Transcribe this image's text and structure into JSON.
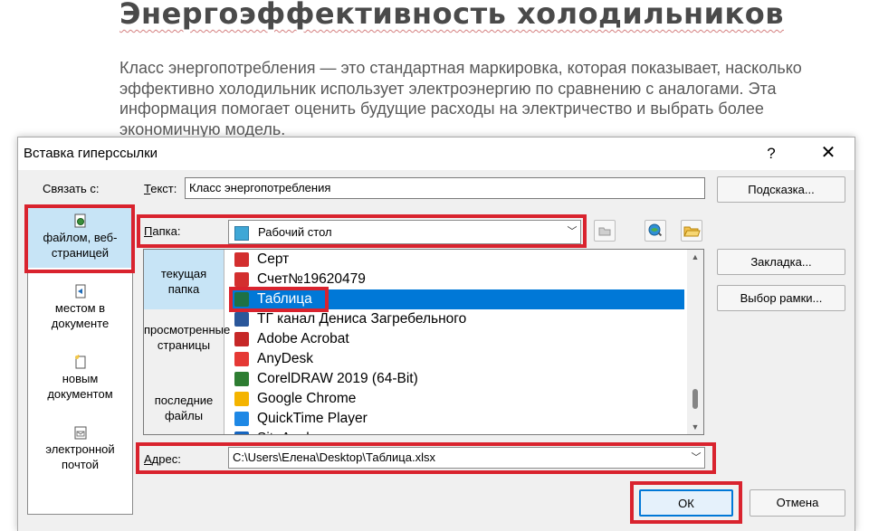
{
  "document": {
    "title": "Энергоэффективность холодильников",
    "paragraph": "Класс энергопотребления — это стандартная маркировка, которая показывает, насколько эффективно холодильник использует электроэнергию по сравнению с аналогами. Эта информация помогает оценить будущие расходы на электричество и выбрать более экономичную модель."
  },
  "dialog": {
    "title": "Вставка гиперссылки",
    "help": "?",
    "close": "✕",
    "link_to_label": "Связать с:",
    "text_label": "Текст:",
    "text_value": "Класс энергопотребления",
    "tooltip_button": "Подсказка...",
    "folder_label": "Папка:",
    "folder_value": "Рабочий стол",
    "bookmark_button": "Закладка...",
    "frame_button": "Выбор рамки...",
    "address_label": "Адрес:",
    "address_value": "C:\\Users\\Елена\\Desktop\\Таблица.xlsx",
    "ok_button": "ОК",
    "cancel_button": "Отмена",
    "link_bar": [
      {
        "label": "файлом, веб-страницей",
        "icon": "web-page-icon",
        "selected": true
      },
      {
        "label": "местом в документе",
        "icon": "place-in-document-icon",
        "selected": false
      },
      {
        "label": "новым документом",
        "icon": "new-document-icon",
        "selected": false
      },
      {
        "label": "электронной почтой",
        "icon": "email-icon",
        "selected": false
      }
    ],
    "browse_sources": [
      {
        "label": "текущая папка",
        "selected": true
      },
      {
        "label": "просмотренные страницы",
        "selected": false
      },
      {
        "label": "последние файлы",
        "selected": false
      }
    ],
    "files": [
      {
        "name": "Серт",
        "icon": "pdf-icon",
        "color": "#d32f2f"
      },
      {
        "name": "Счет№19620479",
        "icon": "pdf-icon",
        "color": "#d32f2f"
      },
      {
        "name": "Таблица",
        "icon": "excel-icon",
        "color": "#1e7145",
        "selected": true
      },
      {
        "name": "ТГ канал Дениса Загребельного",
        "icon": "word-icon",
        "color": "#2b579a"
      },
      {
        "name": "Adobe Acrobat",
        "icon": "acrobat-shortcut-icon",
        "color": "#c62828"
      },
      {
        "name": "AnyDesk",
        "icon": "anydesk-shortcut-icon",
        "color": "#e53935"
      },
      {
        "name": "CorelDRAW 2019 (64-Bit)",
        "icon": "coreldraw-shortcut-icon",
        "color": "#2e7d32"
      },
      {
        "name": "Google Chrome",
        "icon": "chrome-shortcut-icon",
        "color": "#f4b400"
      },
      {
        "name": "QuickTime Player",
        "icon": "quicktime-shortcut-icon",
        "color": "#1e88e5"
      },
      {
        "name": "SiteAnalyzer",
        "icon": "siteanalyzer-shortcut-icon",
        "color": "#1565c0"
      }
    ],
    "highlight_color": "#d9232e"
  }
}
